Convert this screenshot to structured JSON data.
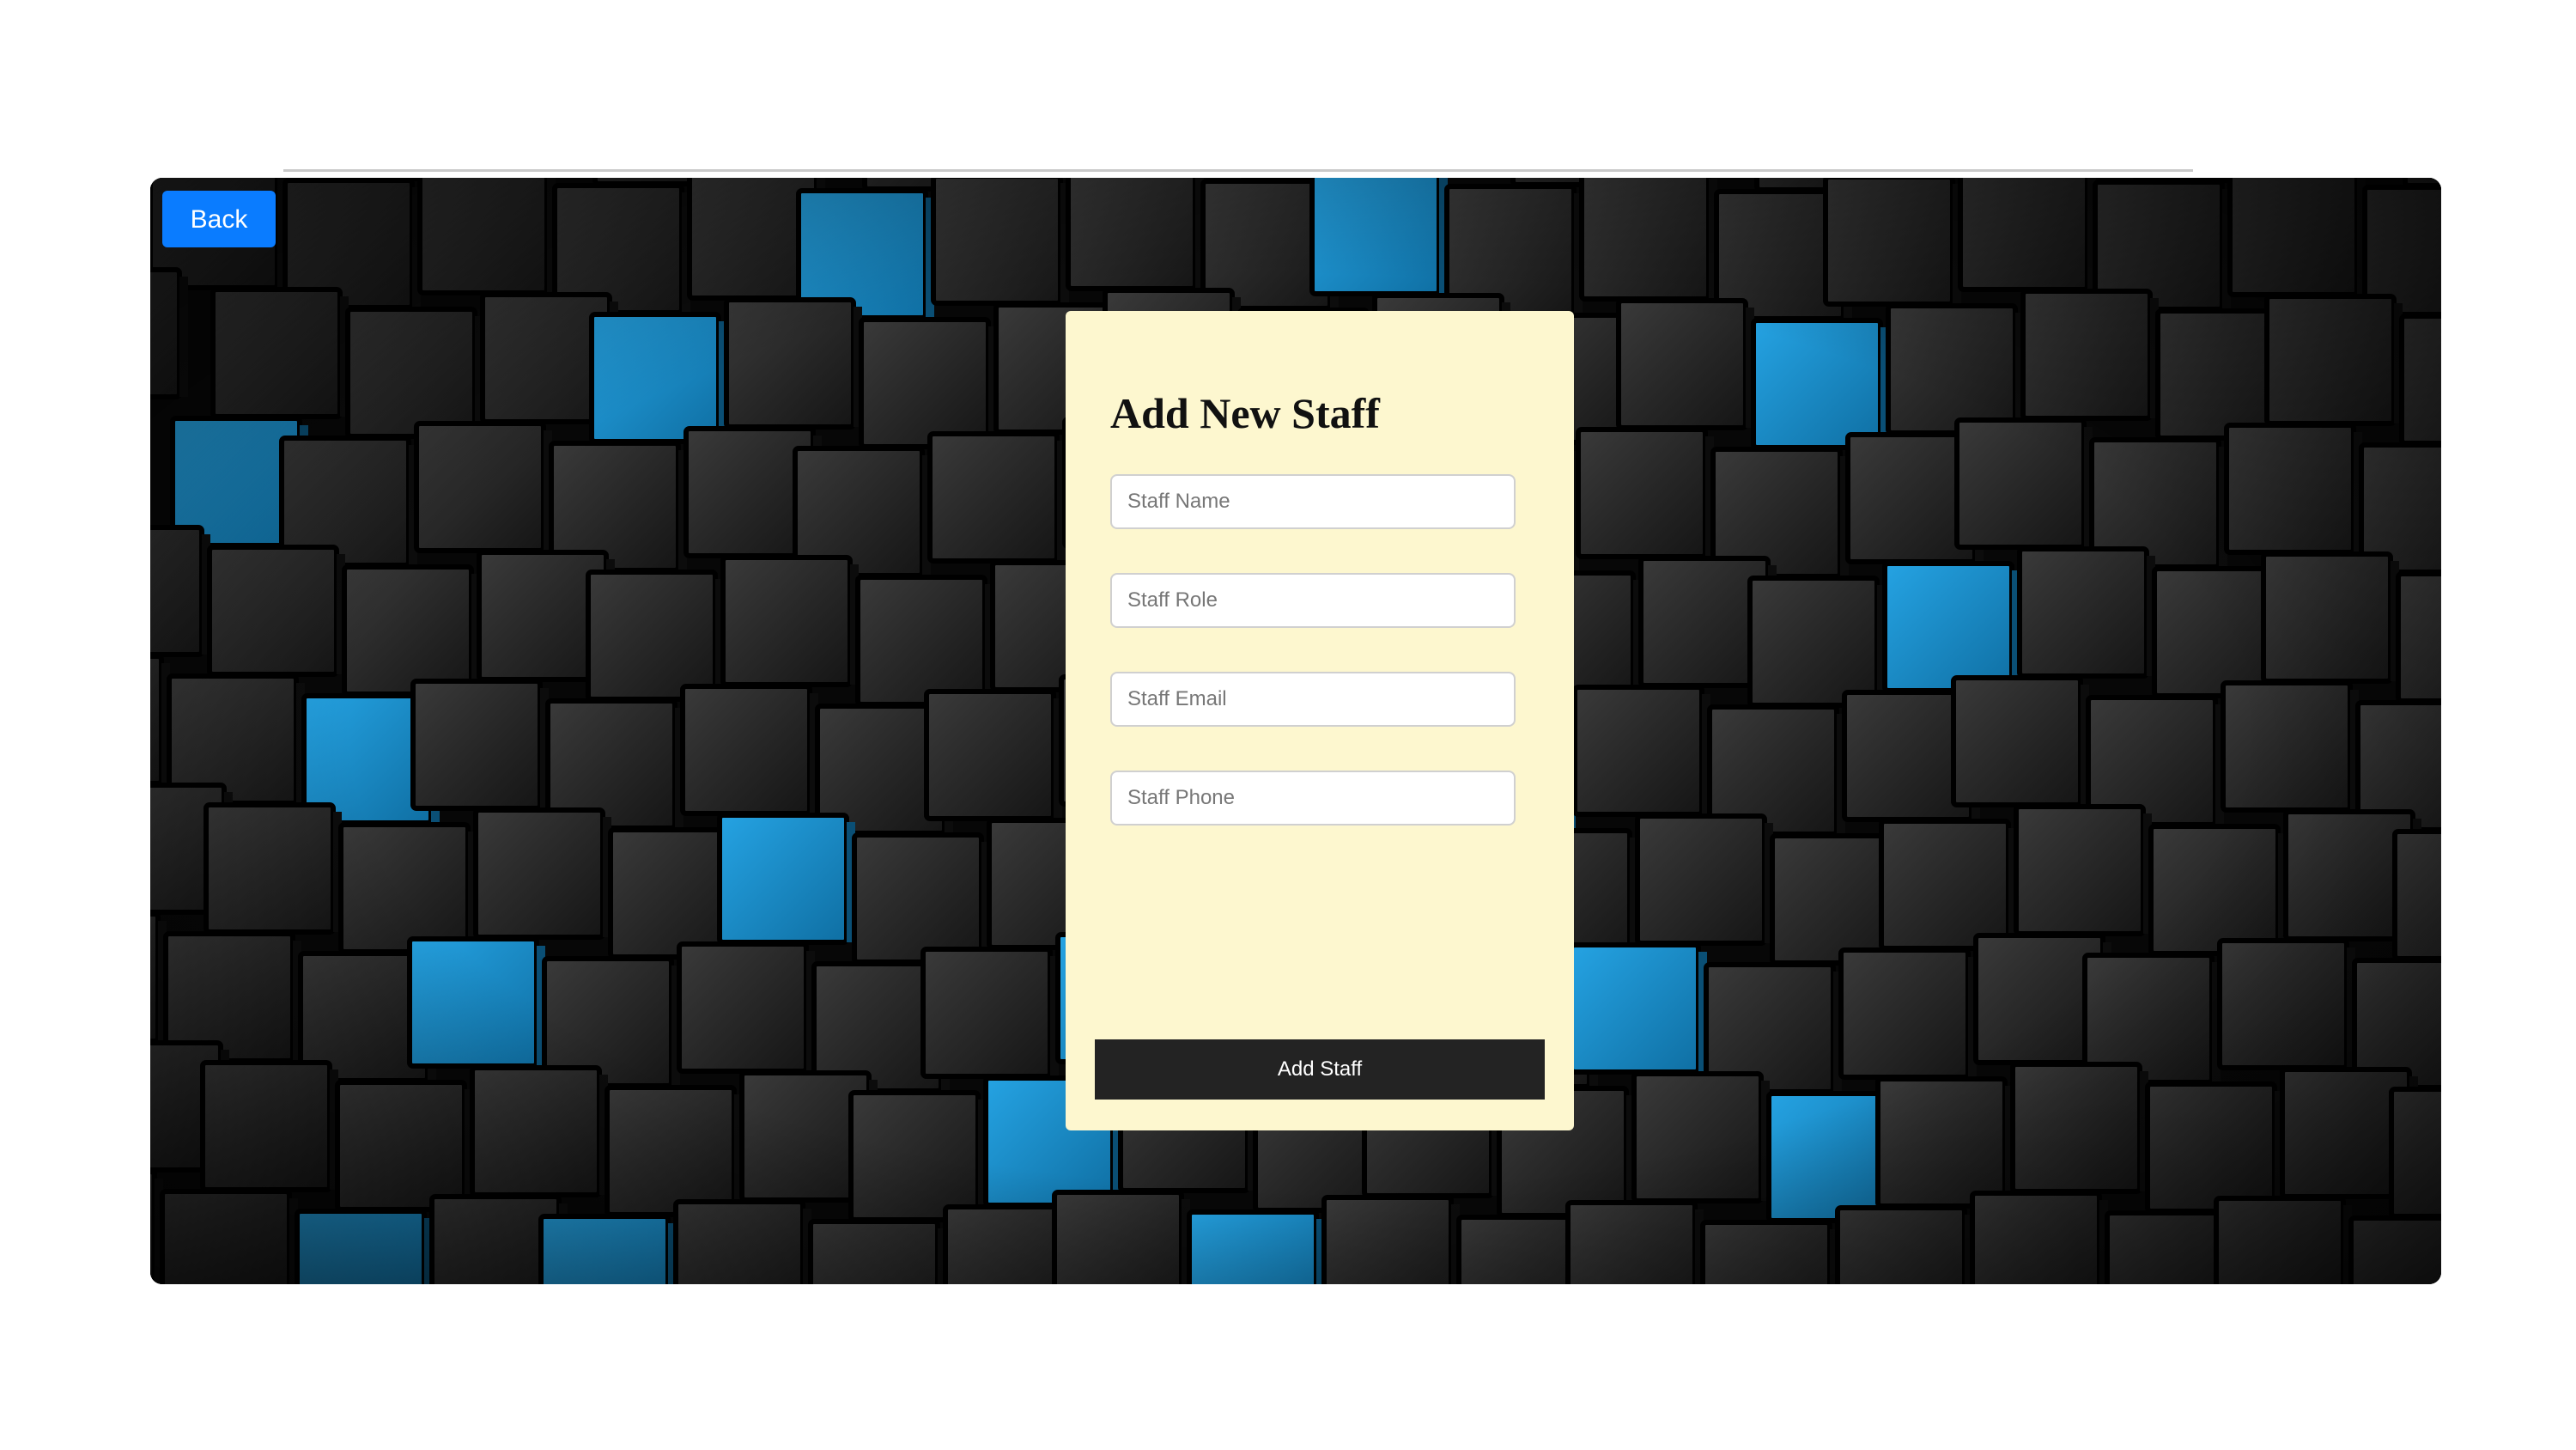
{
  "navigation": {
    "back_label": "Back"
  },
  "form": {
    "title": "Add New Staff",
    "fields": {
      "name": {
        "value": "",
        "placeholder": "Staff Name"
      },
      "role": {
        "value": "",
        "placeholder": "Staff Role"
      },
      "email": {
        "value": "",
        "placeholder": "Staff Email"
      },
      "phone": {
        "value": "",
        "placeholder": "Staff Phone"
      }
    },
    "submit_label": "Add Staff"
  },
  "colors": {
    "back_button": "#0a7cff",
    "form_card": "#fdf7cf",
    "submit_button": "#232323",
    "background_accent": "#1590cf",
    "background_base": "#050505"
  },
  "background": {
    "description_icon": "cubes-pattern"
  }
}
